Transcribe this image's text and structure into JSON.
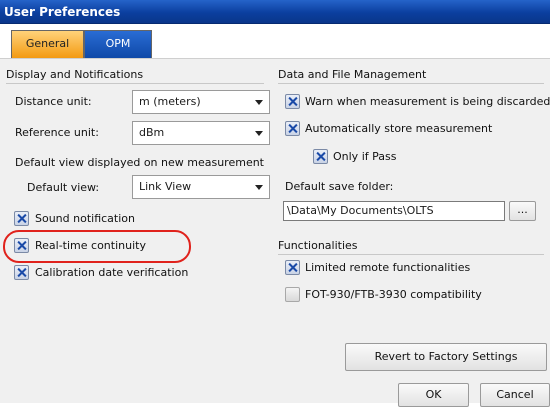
{
  "window": {
    "title": "User Preferences"
  },
  "tabs": [
    {
      "label": "General",
      "active": true
    },
    {
      "label": "OPM",
      "active": false
    }
  ],
  "display": {
    "group_title": "Display and Notifications",
    "distance_unit": {
      "label": "Distance unit:",
      "value": "m (meters)"
    },
    "reference_unit": {
      "label": "Reference unit:",
      "value": "dBm"
    },
    "default_view_heading": "Default view displayed on new measurement",
    "default_view": {
      "label": "Default view:",
      "value": "Link View"
    },
    "checkboxes": [
      {
        "label": "Sound notification",
        "checked": true
      },
      {
        "label": "Real-time continuity",
        "checked": true
      },
      {
        "label": "Calibration date verification",
        "checked": true
      }
    ]
  },
  "data": {
    "group_title": "Data and File Management",
    "warn": {
      "label": "Warn when measurement is being discarded",
      "checked": true
    },
    "auto_store": {
      "label": "Automatically store measurement",
      "checked": true
    },
    "only_pass": {
      "label": "Only if Pass",
      "checked": true
    },
    "save_folder_label": "Default save folder:",
    "save_folder_value": "\\Data\\My Documents\\OLTS",
    "browse_label": "..."
  },
  "functionalities": {
    "group_title": "Functionalities",
    "limited_remote": {
      "label": "Limited remote functionalities",
      "checked": true
    },
    "fot_compat": {
      "label": "FOT-930/FTB-3930 compatibility",
      "checked": false
    }
  },
  "buttons": {
    "revert": "Revert to Factory Settings",
    "ok": "OK",
    "cancel": "Cancel"
  },
  "colors": {
    "title_bar": "#0b3f9f",
    "tab_active": "#f39a12",
    "tab_inactive": "#0f49a8",
    "highlight": "#e0221c"
  }
}
